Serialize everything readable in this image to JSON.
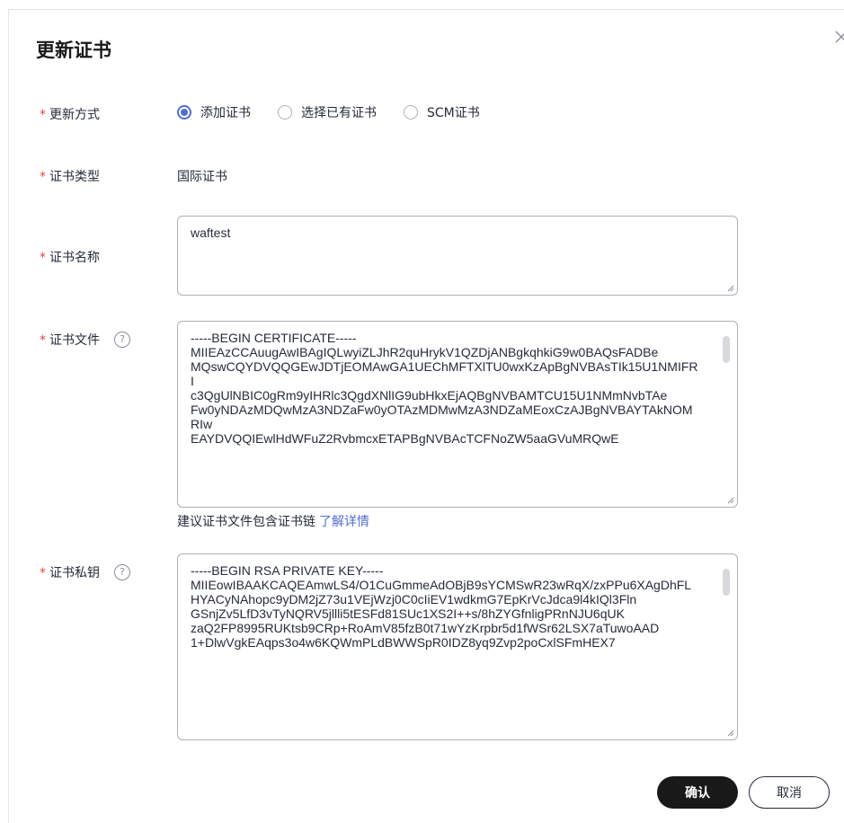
{
  "dialog": {
    "title": "更新证书",
    "confirm_label": "确认",
    "cancel_label": "取消"
  },
  "form": {
    "update_method": {
      "label": "更新方式",
      "options": [
        {
          "label": "添加证书",
          "checked": true
        },
        {
          "label": "选择已有证书",
          "checked": false
        },
        {
          "label": "SCM证书",
          "checked": false
        }
      ]
    },
    "cert_type": {
      "label": "证书类型",
      "value": "国际证书"
    },
    "cert_name": {
      "label": "证书名称",
      "value": "waftest"
    },
    "cert_file": {
      "label": "证书文件",
      "help_icon": "question-circle-icon",
      "value": "-----BEGIN CERTIFICATE-----\nMIIEAzCCAuugAwIBAgIQLwyiZLJhR2quHrykV1QZDjANBgkqhkiG9w0BAQsFADBe\nMQswCQYDVQQGEwJDTjEOMAwGA1UEChMFTXlTU0wxKzApBgNVBAsTIk15U1NMIFRI\nc3QgUlNBIC0gRm9yIHRlc3QgdXNlIG9ubHkxEjAQBgNVBAMTCU15U1NMmNvbTAe\nFw0yNDAzMDQwMzA3NDZaFw0yOTAzMDMwMzA3NDZaMEoxCzAJBgNVBAYTAkNOMRIw\nEAYDVQQIEwlHdWFuZ2RvbmcxETAPBgNVBAcTCFNoZW5aaGVuMRQwE",
      "hint": "建议证书文件包含证书链",
      "hint_link": "了解详情"
    },
    "private_key": {
      "label": "证书私钥",
      "help_icon": "question-circle-icon",
      "value": "-----BEGIN RSA PRIVATE KEY-----\nMIIEowIBAAKCAQEAmwLS4/O1CuGmmeAdOBjB9sYCMSwR23wRqX/zxPPu6XAgDhFL\nHYACyNAhopc9yDM2jZ73u1VEjWzj0C0cIiEV1wdkmG7EpKrVcJdca9l4kIQl3Fln\nGSnjZv5LfD3vTyNQRV5jllli5tESFd81SUc1XS2I++s/8hZYGfnligPRnNJU6qUK\nzaQ2FP8995RUKtsb9CRp+RoAmV85fzB0t71wYzKrpbr5d1fWSr62LSX7aTuwoAAD\n1+DlwVgkEAqps3o4w6KQWmPLdBWWSpR0IDZ8yq9Zvp2poCxlSFmHEX7"
    }
  },
  "colors": {
    "required_star": "#e54545",
    "accent": "#526ecc",
    "primary_button": "#191919"
  }
}
